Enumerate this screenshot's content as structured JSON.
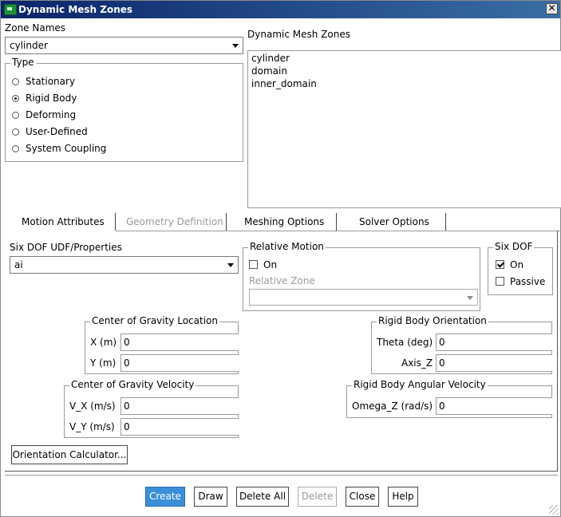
{
  "window": {
    "title": "Dynamic Mesh Zones",
    "close_glyph": "✕"
  },
  "zone_names": {
    "label": "Zone Names",
    "value": "cylinder"
  },
  "type": {
    "label": "Type",
    "options": [
      {
        "label": "Stationary",
        "selected": false
      },
      {
        "label": "Rigid Body",
        "selected": true
      },
      {
        "label": "Deforming",
        "selected": false
      },
      {
        "label": "User-Defined",
        "selected": false
      },
      {
        "label": "System Coupling",
        "selected": false
      }
    ]
  },
  "dynamic_mesh_zones": {
    "label": "Dynamic Mesh Zones",
    "items": [
      "cylinder",
      "domain",
      "inner_domain"
    ]
  },
  "tabs": [
    {
      "label": "Motion Attributes",
      "active": true,
      "enabled": true
    },
    {
      "label": "Geometry Definition",
      "active": false,
      "enabled": false
    },
    {
      "label": "Meshing Options",
      "active": false,
      "enabled": true
    },
    {
      "label": "Solver Options",
      "active": false,
      "enabled": true
    }
  ],
  "six_dof_udf": {
    "label": "Six DOF UDF/Properties",
    "value": "ai"
  },
  "relative_motion": {
    "label": "Relative Motion",
    "on_label": "On",
    "on_checked": false,
    "relative_zone_label": "Relative Zone",
    "relative_zone_value": ""
  },
  "six_dof": {
    "label": "Six DOF",
    "on_label": "On",
    "on_checked": true,
    "passive_label": "Passive",
    "passive_checked": false
  },
  "cog_location": {
    "label": "Center of Gravity Location",
    "x_label": "X (m)",
    "x_value": "0",
    "y_label": "Y (m)",
    "y_value": "0"
  },
  "rb_orientation": {
    "label": "Rigid Body Orientation",
    "theta_label": "Theta (deg)",
    "theta_value": "0",
    "axis_label": "Axis_Z",
    "axis_value": "0"
  },
  "cog_velocity": {
    "label": "Center of Gravity Velocity",
    "vx_label": "V_X (m/s)",
    "vx_value": "0",
    "vy_label": "V_Y (m/s)",
    "vy_value": "0"
  },
  "rb_angular_velocity": {
    "label": "Rigid Body Angular Velocity",
    "omega_label": "Omega_Z (rad/s)",
    "omega_value": "0"
  },
  "orientation_calculator": {
    "label": "Orientation Calculator..."
  },
  "buttons": {
    "create": "Create",
    "draw": "Draw",
    "delete_all": "Delete All",
    "delete": "Delete",
    "close": "Close",
    "help": "Help"
  },
  "colors": {
    "title_bar": "#0a246a",
    "primary_button": "#3b8fd9"
  }
}
